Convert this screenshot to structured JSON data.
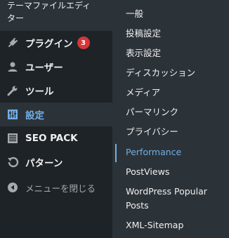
{
  "sidebar": {
    "top_item": {
      "line1": "テーマファイルエディ",
      "line2": "ター"
    },
    "items": [
      {
        "label": "プラグイン",
        "icon": "plugin-icon",
        "badge": "3"
      },
      {
        "label": "ユーザー",
        "icon": "user-icon"
      },
      {
        "label": "ツール",
        "icon": "wrench-icon"
      },
      {
        "label": "設定",
        "icon": "settings-sliders-icon",
        "current": true
      },
      {
        "label": "SEO PACK",
        "icon": "list-icon"
      },
      {
        "label": "パターン",
        "icon": "undo-icon"
      },
      {
        "label": "メニューを閉じる",
        "icon": "collapse-icon"
      }
    ]
  },
  "submenu": {
    "items": [
      {
        "label": "一般"
      },
      {
        "label": "投稿設定"
      },
      {
        "label": "表示設定"
      },
      {
        "label": "ディスカッション"
      },
      {
        "label": "メディア"
      },
      {
        "label": "パーマリンク"
      },
      {
        "label": "プライバシー"
      },
      {
        "label": "Performance",
        "current": true
      },
      {
        "label": "PostViews"
      },
      {
        "label": "WordPress Popular Posts"
      },
      {
        "label": "XML-Sitemap"
      }
    ]
  },
  "colors": {
    "sidebar_bg": "#1d2327",
    "submenu_bg": "#2c3338",
    "accent": "#72aee6",
    "badge": "#d63638"
  }
}
